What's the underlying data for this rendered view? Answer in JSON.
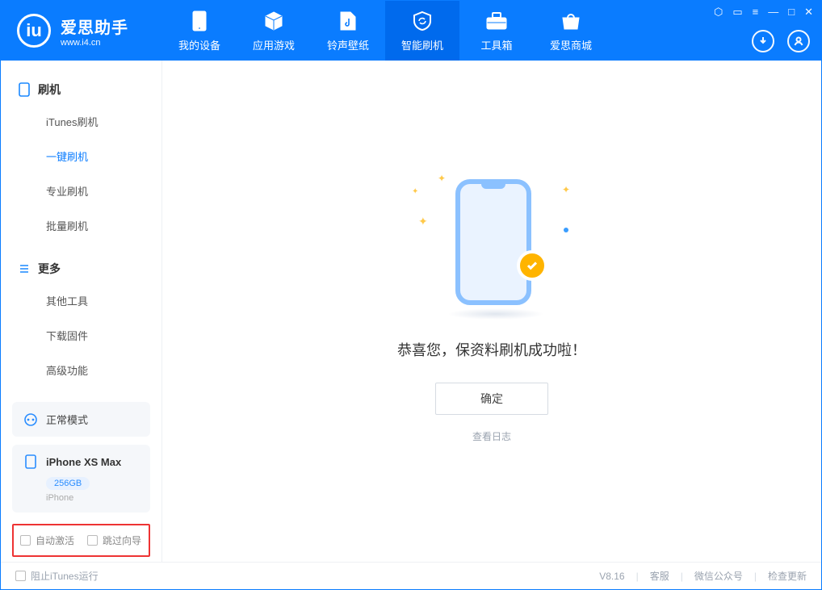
{
  "brand": {
    "name": "爱思助手",
    "site": "www.i4.cn"
  },
  "navtabs": [
    {
      "id": "device",
      "label": "我的设备"
    },
    {
      "id": "apps",
      "label": "应用游戏"
    },
    {
      "id": "ringwall",
      "label": "铃声壁纸"
    },
    {
      "id": "flash",
      "label": "智能刷机"
    },
    {
      "id": "toolbox",
      "label": "工具箱"
    },
    {
      "id": "store",
      "label": "爱思商城"
    }
  ],
  "sidebar": {
    "g1_title": "刷机",
    "g1_items": [
      {
        "label": "iTunes刷机"
      },
      {
        "label": "一键刷机"
      },
      {
        "label": "专业刷机"
      },
      {
        "label": "批量刷机"
      }
    ],
    "g2_title": "更多",
    "g2_items": [
      {
        "label": "其他工具"
      },
      {
        "label": "下载固件"
      },
      {
        "label": "高级功能"
      }
    ],
    "mode_label": "正常模式",
    "device": {
      "name": "iPhone XS Max",
      "capacity": "256GB",
      "type": "iPhone"
    },
    "opt_auto_activate": "自动激活",
    "opt_skip_guide": "跳过向导"
  },
  "main": {
    "success_msg": "恭喜您，保资料刷机成功啦！",
    "ok": "确定",
    "view_log": "查看日志"
  },
  "footer": {
    "block_itunes": "阻止iTunes运行",
    "version": "V8.16",
    "support": "客服",
    "wechat": "微信公众号",
    "update": "检查更新"
  }
}
